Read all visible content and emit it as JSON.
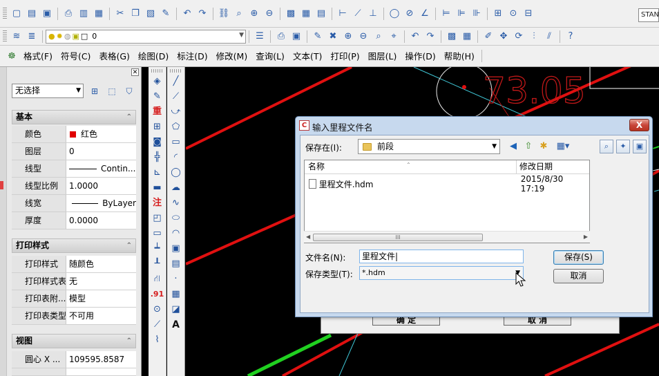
{
  "toolbar2": {
    "layer_value": "0"
  },
  "toolbar1": {
    "text_style_value": "STANDARD"
  },
  "menu": [
    "格式(F)",
    "符号(C)",
    "表格(G)",
    "绘图(D)",
    "标注(D)",
    "修改(M)",
    "查询(L)",
    "文本(T)",
    "打印(P)",
    "图层(L)",
    "操作(D)",
    "帮助(H)"
  ],
  "properties": {
    "selection": "无选择",
    "sections": {
      "basic": "基本",
      "print_style": "打印样式",
      "view": "视图"
    },
    "basic_rows": [
      {
        "key": "颜色",
        "value": "红色"
      },
      {
        "key": "图层",
        "value": "0"
      },
      {
        "key": "线型",
        "value": "Contin..."
      },
      {
        "key": "线型比例",
        "value": "1.0000"
      },
      {
        "key": "线宽",
        "value": "ByLayer"
      },
      {
        "key": "厚度",
        "value": "0.0000"
      }
    ],
    "print_rows": [
      {
        "key": "打印样式",
        "value": "随颜色"
      },
      {
        "key": "打印样式表",
        "value": "无"
      },
      {
        "key": "打印表附...",
        "value": "模型"
      },
      {
        "key": "打印表类型",
        "value": "不可用"
      }
    ],
    "view_rows": [
      {
        "key": "圆心 X ...",
        "value": "109595.8587"
      }
    ],
    "colors": {
      "color_swatch": "#e00000"
    }
  },
  "draw_toolbar": {
    "glyphs": [
      "重",
      "注",
      ".91",
      "A"
    ]
  },
  "canvas": {
    "dimension_text": "73.05",
    "colors": {
      "red_line": "#e01010",
      "green_line": "#20d020",
      "cyan_line": "#40c8d8",
      "dim_red": "#c01818"
    }
  },
  "dialog": {
    "title": "输入里程文件名",
    "close_label": "X",
    "save_in_label": "保存在(I):",
    "save_in_value": "前段",
    "columns": {
      "name": "名称",
      "modified": "修改日期"
    },
    "files": [
      {
        "name": "里程文件.hdm",
        "modified": "2015/8/30 17:19"
      }
    ],
    "scroll_thumb": "III",
    "filename_label": "文件名(N):",
    "filename_value": "里程文件|",
    "filetype_label": "保存类型(T):",
    "filetype_value": "*.hdm",
    "save_button": "保存(S)",
    "cancel_button": "取消"
  },
  "behind_dialog": {
    "ok_label": "确 定",
    "cancel_label": "取 消"
  }
}
